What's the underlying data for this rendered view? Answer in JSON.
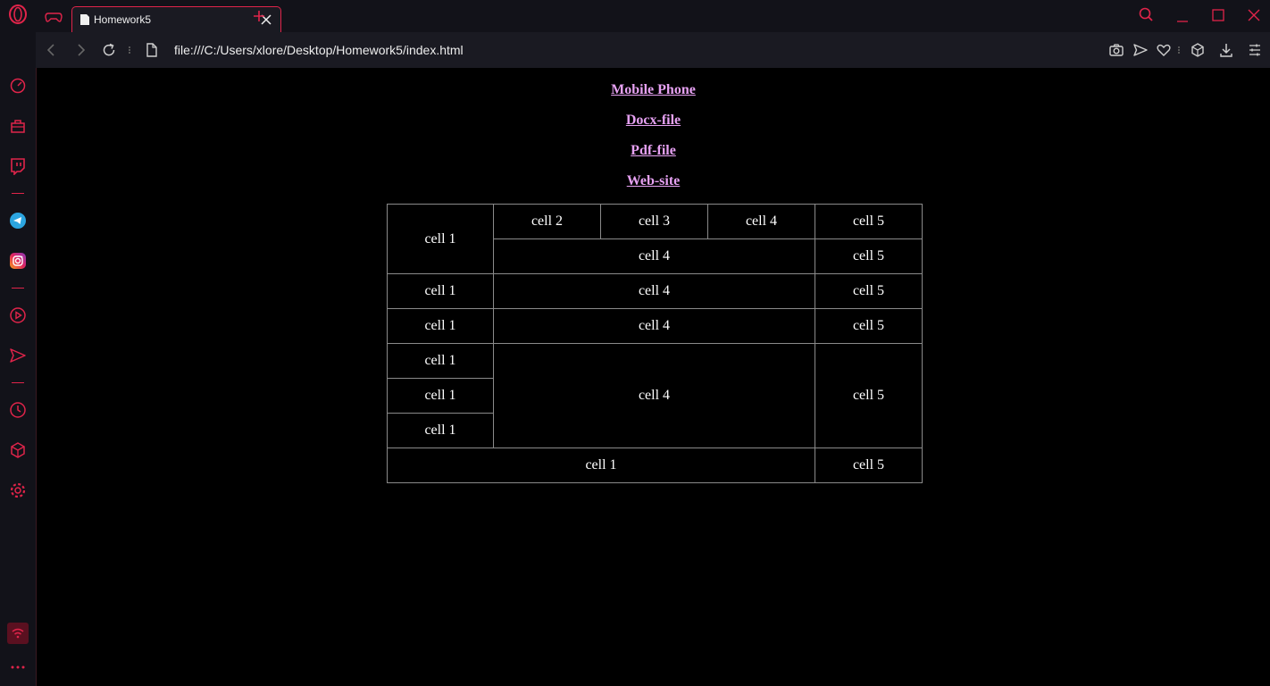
{
  "browser": {
    "tab_title": "Homework5",
    "url": "file:///C:/Users/xlore/Desktop/Homework5/index.html",
    "accent_color": "#e0244a"
  },
  "sidebar": {
    "icons": [
      "opera-logo-icon",
      "speed-dial-icon",
      "shopping-bag-icon",
      "twitch-icon",
      "telegram-icon",
      "instagram-icon",
      "player-icon",
      "flow-icon",
      "history-icon",
      "extensions-icon",
      "settings-icon",
      "wifi-icon",
      "more-icon"
    ]
  },
  "page": {
    "links": [
      "Mobile Phone",
      "Docx-file",
      "Pdf-file",
      "Web-site"
    ],
    "link_color": "#e6a1f2",
    "table": {
      "r1": {
        "a": "cell 1",
        "b": "cell 2",
        "c": "cell 3",
        "d": "cell 4",
        "e": "cell 5"
      },
      "r2": {
        "d": "cell 4",
        "e": "cell 5"
      },
      "r3": {
        "a": "cell 1",
        "d": "cell 4",
        "e": "cell 5"
      },
      "r4": {
        "a": "cell 1",
        "d": "cell 4",
        "e": "cell 5"
      },
      "r5": {
        "a": "cell 1",
        "d": "cell 4",
        "e": "cell 5"
      },
      "r6": {
        "a": "cell 1"
      },
      "r7": {
        "a": "cell 1"
      },
      "r8": {
        "a": "cell 1",
        "e": "cell 5"
      }
    }
  }
}
